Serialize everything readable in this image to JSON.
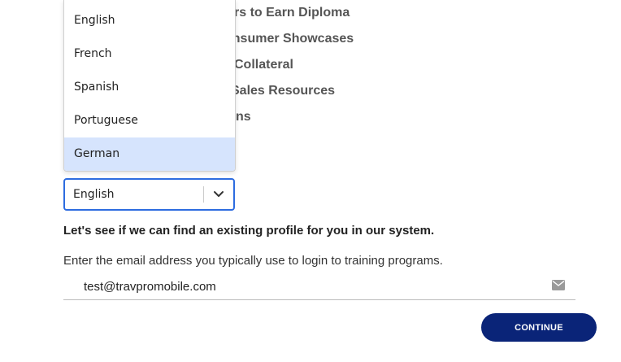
{
  "background_list": [
    "pters to Earn Diploma",
    "onsumer Showcases",
    "Collateral",
    "Sales Resources",
    "ns"
  ],
  "language_dropdown": {
    "options": [
      "English",
      "French",
      "Spanish",
      "Portuguese",
      "German"
    ],
    "highlighted": "German",
    "selected_value": "English"
  },
  "profile_lookup": {
    "heading": "Let's see if we can find an existing profile for you in our system.",
    "instruction": "Enter the email address you typically use to login to training programs.",
    "email_value": "test@travpromobile.com",
    "email_icon": "envelope-icon"
  },
  "continue_label": "CONTINUE",
  "colors": {
    "highlight": "#d6e4fd",
    "focus_border": "#2d6ce0",
    "button_bg": "#0a2478"
  }
}
